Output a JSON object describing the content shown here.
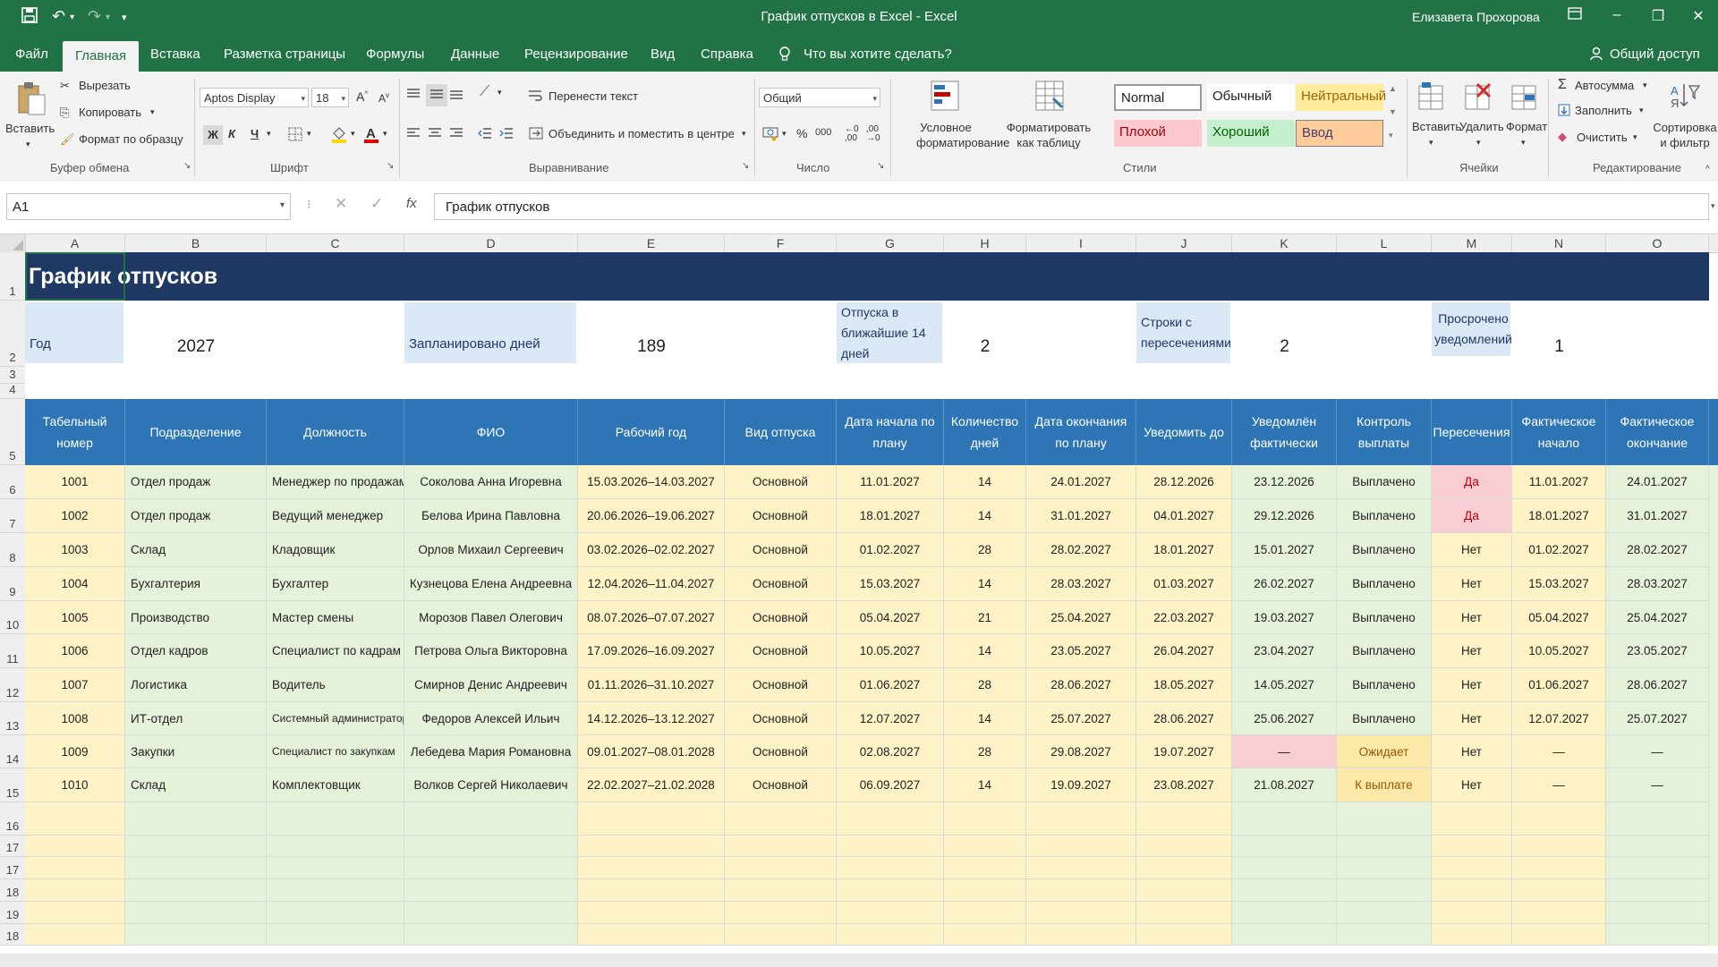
{
  "window": {
    "title": "График отпусков в Excel  -  Excel",
    "user": "Елизавета Прохорова"
  },
  "menu": {
    "tabs": [
      "Файл",
      "Главная",
      "Вставка",
      "Разметка страницы",
      "Формулы",
      "Данные",
      "Рецензирование",
      "Вид",
      "Справка"
    ],
    "tell_me": "Что вы хотите сделать?",
    "share": "Общий доступ"
  },
  "ribbon": {
    "clipboard": {
      "paste": "Вставить",
      "cut": "Вырезать",
      "copy": "Копировать",
      "format_painter": "Формат по образцу",
      "group": "Буфер обмена"
    },
    "font": {
      "name": "Aptos Display",
      "size": "18",
      "bold": "Ж",
      "italic": "К",
      "underline": "Ч",
      "group": "Шрифт"
    },
    "alignment": {
      "wrap": "Перенести текст",
      "merge": "Объединить и поместить в центре",
      "group": "Выравнивание"
    },
    "number": {
      "format": "Общий",
      "percent": "%",
      "thousands": "000",
      "group": "Число"
    },
    "styles": {
      "conditional": "Условное форматирование",
      "format_table": "Форматировать как таблицу",
      "normal_en": "Normal",
      "normal": "Обычный",
      "neutral": "Нейтральный",
      "bad": "Плохой",
      "good": "Хороший",
      "input": "Ввод",
      "group": "Стили"
    },
    "cells": {
      "insert": "Вставить",
      "delete": "Удалить",
      "format": "Формат",
      "group": "Ячейки"
    },
    "editing": {
      "autosum": "Автосумма",
      "fill": "Заполнить",
      "clear": "Очистить",
      "sort": "Сортировка и фильтр",
      "group": "Редактирование"
    }
  },
  "formula_bar": {
    "name_box": "A1",
    "content": "График отпусков",
    "fx": "fx"
  },
  "columns": [
    "A",
    "B",
    "C",
    "D",
    "E",
    "F",
    "G",
    "H",
    "I",
    "J",
    "K",
    "L",
    "M",
    "N",
    "O"
  ],
  "row_numbers": [
    "1",
    "2",
    "3",
    "4",
    "5",
    "6",
    "7",
    "8",
    "9",
    "10",
    "11",
    "12",
    "13",
    "14",
    "15",
    "16",
    "17",
    "17",
    "18",
    "19",
    "18",
    "15"
  ],
  "sheet": {
    "title": "График отпусков",
    "kpis": {
      "year_label": "Год",
      "year_value": "2027",
      "planned_label": "Запланировано дней",
      "planned_value": "189",
      "upcoming_label": "Отпуска в ближайшие 14 дней",
      "upcoming_value": "2",
      "overlap_label": "Строки с пересечениями",
      "overlap_value": "2",
      "overdue_label": "Просрочено уведомлений",
      "overdue_value": "1"
    },
    "headers": [
      "Табельный номер",
      "Подразделение",
      "Должность",
      "ФИО",
      "Рабочий год",
      "Вид отпуска",
      "Дата начала по плану",
      "Количество дней",
      "Дата окончания по плану",
      "Уведомить до",
      "Уведомлён фактически",
      "Контроль выплаты",
      "Пересечения",
      "Фактическое начало",
      "Фактическое окончание"
    ],
    "rows": [
      [
        "1001",
        "Отдел продаж",
        "Менеджер по продажам",
        "Соколова Анна Игоревна",
        "15.03.2026–14.03.2027",
        "Основной",
        "11.01.2027",
        "14",
        "24.01.2027",
        "28.12.2026",
        "23.12.2026",
        "Выплачено",
        "Да",
        "11.01.2027",
        "24.01.2027"
      ],
      [
        "1002",
        "Отдел продаж",
        "Ведущий менеджер",
        "Белова Ирина Павловна",
        "20.06.2026–19.06.2027",
        "Основной",
        "18.01.2027",
        "14",
        "31.01.2027",
        "04.01.2027",
        "29.12.2026",
        "Выплачено",
        "Да",
        "18.01.2027",
        "31.01.2027"
      ],
      [
        "1003",
        "Склад",
        "Кладовщик",
        "Орлов Михаил Сергеевич",
        "03.02.2026–02.02.2027",
        "Основной",
        "01.02.2027",
        "28",
        "28.02.2027",
        "18.01.2027",
        "15.01.2027",
        "Выплачено",
        "Нет",
        "01.02.2027",
        "28.02.2027"
      ],
      [
        "1004",
        "Бухгалтерия",
        "Бухгалтер",
        "Кузнецова Елена Андреевна",
        "12.04.2026–11.04.2027",
        "Основной",
        "15.03.2027",
        "14",
        "28.03.2027",
        "01.03.2027",
        "26.02.2027",
        "Выплачено",
        "Нет",
        "15.03.2027",
        "28.03.2027"
      ],
      [
        "1005",
        "Производство",
        "Мастер смены",
        "Морозов Павел Олегович",
        "08.07.2026–07.07.2027",
        "Основной",
        "05.04.2027",
        "21",
        "25.04.2027",
        "22.03.2027",
        "19.03.2027",
        "Выплачено",
        "Нет",
        "05.04.2027",
        "25.04.2027"
      ],
      [
        "1006",
        "Отдел кадров",
        "Специалист по кадрам",
        "Петрова Ольга Викторовна",
        "17.09.2026–16.09.2027",
        "Основной",
        "10.05.2027",
        "14",
        "23.05.2027",
        "26.04.2027",
        "23.04.2027",
        "Выплачено",
        "Нет",
        "10.05.2027",
        "23.05.2027"
      ],
      [
        "1007",
        "Логистика",
        "Водитель",
        "Смирнов Денис Андреевич",
        "01.11.2026–31.10.2027",
        "Основной",
        "01.06.2027",
        "28",
        "28.06.2027",
        "18.05.2027",
        "14.05.2027",
        "Выплачено",
        "Нет",
        "01.06.2027",
        "28.06.2027"
      ],
      [
        "1008",
        "ИТ-отдел",
        "Системный администратор",
        "Федоров Алексей Ильич",
        "14.12.2026–13.12.2027",
        "Основной",
        "12.07.2027",
        "14",
        "25.07.2027",
        "28.06.2027",
        "25.06.2027",
        "Выплачено",
        "Нет",
        "12.07.2027",
        "25.07.2027"
      ],
      [
        "1009",
        "Закупки",
        "Специалист по закупкам",
        "Лебедева Мария Романовна",
        "09.01.2027–08.01.2028",
        "Основной",
        "02.08.2027",
        "28",
        "29.08.2027",
        "19.07.2027",
        "—",
        "Ожидает",
        "Нет",
        "—",
        "—"
      ],
      [
        "1010",
        "Склад",
        "Комплектовщик",
        "Волков Сергей Николаевич",
        "22.02.2027–21.02.2028",
        "Основной",
        "06.09.2027",
        "14",
        "19.09.2027",
        "23.08.2027",
        "21.08.2027",
        "К выплате",
        "Нет",
        "—",
        "—"
      ]
    ]
  },
  "colors": {
    "excel_green": "#217346",
    "title_navy": "#1f3864",
    "header_blue": "#2e75b6",
    "row_yellow": "#fdf3c6",
    "row_green": "#e6f1da",
    "flag_red": "#f8cdd3",
    "flag_red_text": "#c00000",
    "pending_yellow": "#fce8a8",
    "pending_text": "#9c5700"
  }
}
